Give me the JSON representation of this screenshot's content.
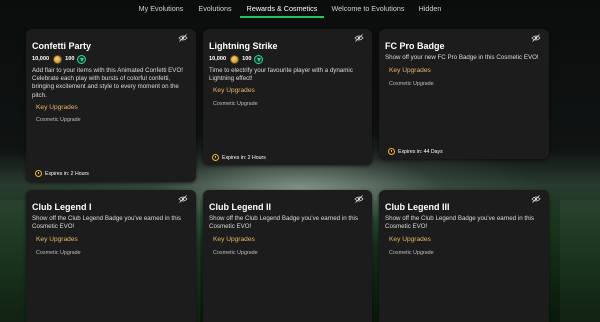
{
  "tabs": [
    {
      "label": "My Evolutions",
      "active": false
    },
    {
      "label": "Evolutions",
      "active": false
    },
    {
      "label": "Rewards & Cosmetics",
      "active": true
    },
    {
      "label": "Welcome to Evolutions",
      "active": false
    },
    {
      "label": "Hidden",
      "active": false
    }
  ],
  "colors": {
    "accent": "#22c55e",
    "key_upgrades": "#e6b86a",
    "expires_icon": "#f0b429",
    "card_bg": "#1c1c1c"
  },
  "cards": [
    {
      "title": "Confetti Party",
      "coins": "10,000",
      "points": "100",
      "description": "Add flair to your items with this Animated Confetti EVO! Celebrate each play with bursts of colorful confetti, bringing excitement and style to every moment on the pitch.",
      "key_upgrades": "Key Upgrades",
      "upgrade": "Cosmetic Upgrade",
      "expires": "Expires in: 2 Hours"
    },
    {
      "title": "Lightning Strike",
      "coins": "10,000",
      "points": "100",
      "description": "Time to electrify your favourite player with a dynamic Lightning effect!",
      "key_upgrades": "Key Upgrades",
      "upgrade": "Cosmetic Upgrade",
      "expires": "Expires in: 2 Hours"
    },
    {
      "title": "FC Pro Badge",
      "description": "Show off your new FC Pro Badge in this Cosmetic EVO!",
      "key_upgrades": "Key Upgrades",
      "upgrade": "Cosmetic Upgrade",
      "expires": "Expires in: 44 Days"
    },
    {
      "title": "Club Legend I",
      "description": "Show off the Club Legend Badge you've earned in this Cosmetic EVO!",
      "key_upgrades": "Key Upgrades",
      "upgrade": "Cosmetic Upgrade"
    },
    {
      "title": "Club Legend II",
      "description": "Show off the Club Legend Badge you've earned in this Cosmetic EVO!",
      "key_upgrades": "Key Upgrades",
      "upgrade": "Cosmetic Upgrade"
    },
    {
      "title": "Club Legend III",
      "description": "Show off the Club Legend Badge you've earned in this Cosmetic EVO!",
      "key_upgrades": "Key Upgrades",
      "upgrade": "Cosmetic Upgrade"
    }
  ]
}
